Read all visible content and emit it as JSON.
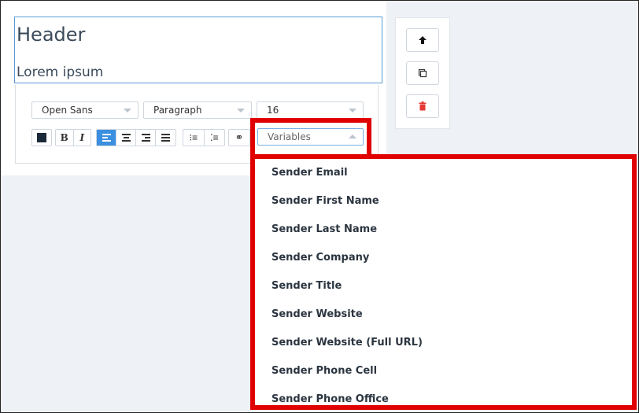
{
  "editor": {
    "header": "Header",
    "body": "Lorem ipsum"
  },
  "toolbar": {
    "font_family": "Open Sans",
    "block_type": "Paragraph",
    "font_size": "16",
    "bold": "B",
    "italic": "I",
    "variables_placeholder": "Variables",
    "text_color": "#1b2a3a"
  },
  "side_panel": {
    "icons": [
      "arrow-up-icon",
      "copy-icon",
      "trash-icon"
    ]
  },
  "variables_dropdown": {
    "items": [
      "Sender Email",
      "Sender First Name",
      "Sender Last Name",
      "Sender Company",
      "Sender Title",
      "Sender Website",
      "Sender Website (Full URL)",
      "Sender Phone Cell",
      "Sender Phone Office"
    ]
  },
  "colors": {
    "accent": "#3b8fe0",
    "highlight": "#e00000",
    "delete": "#e53935"
  }
}
